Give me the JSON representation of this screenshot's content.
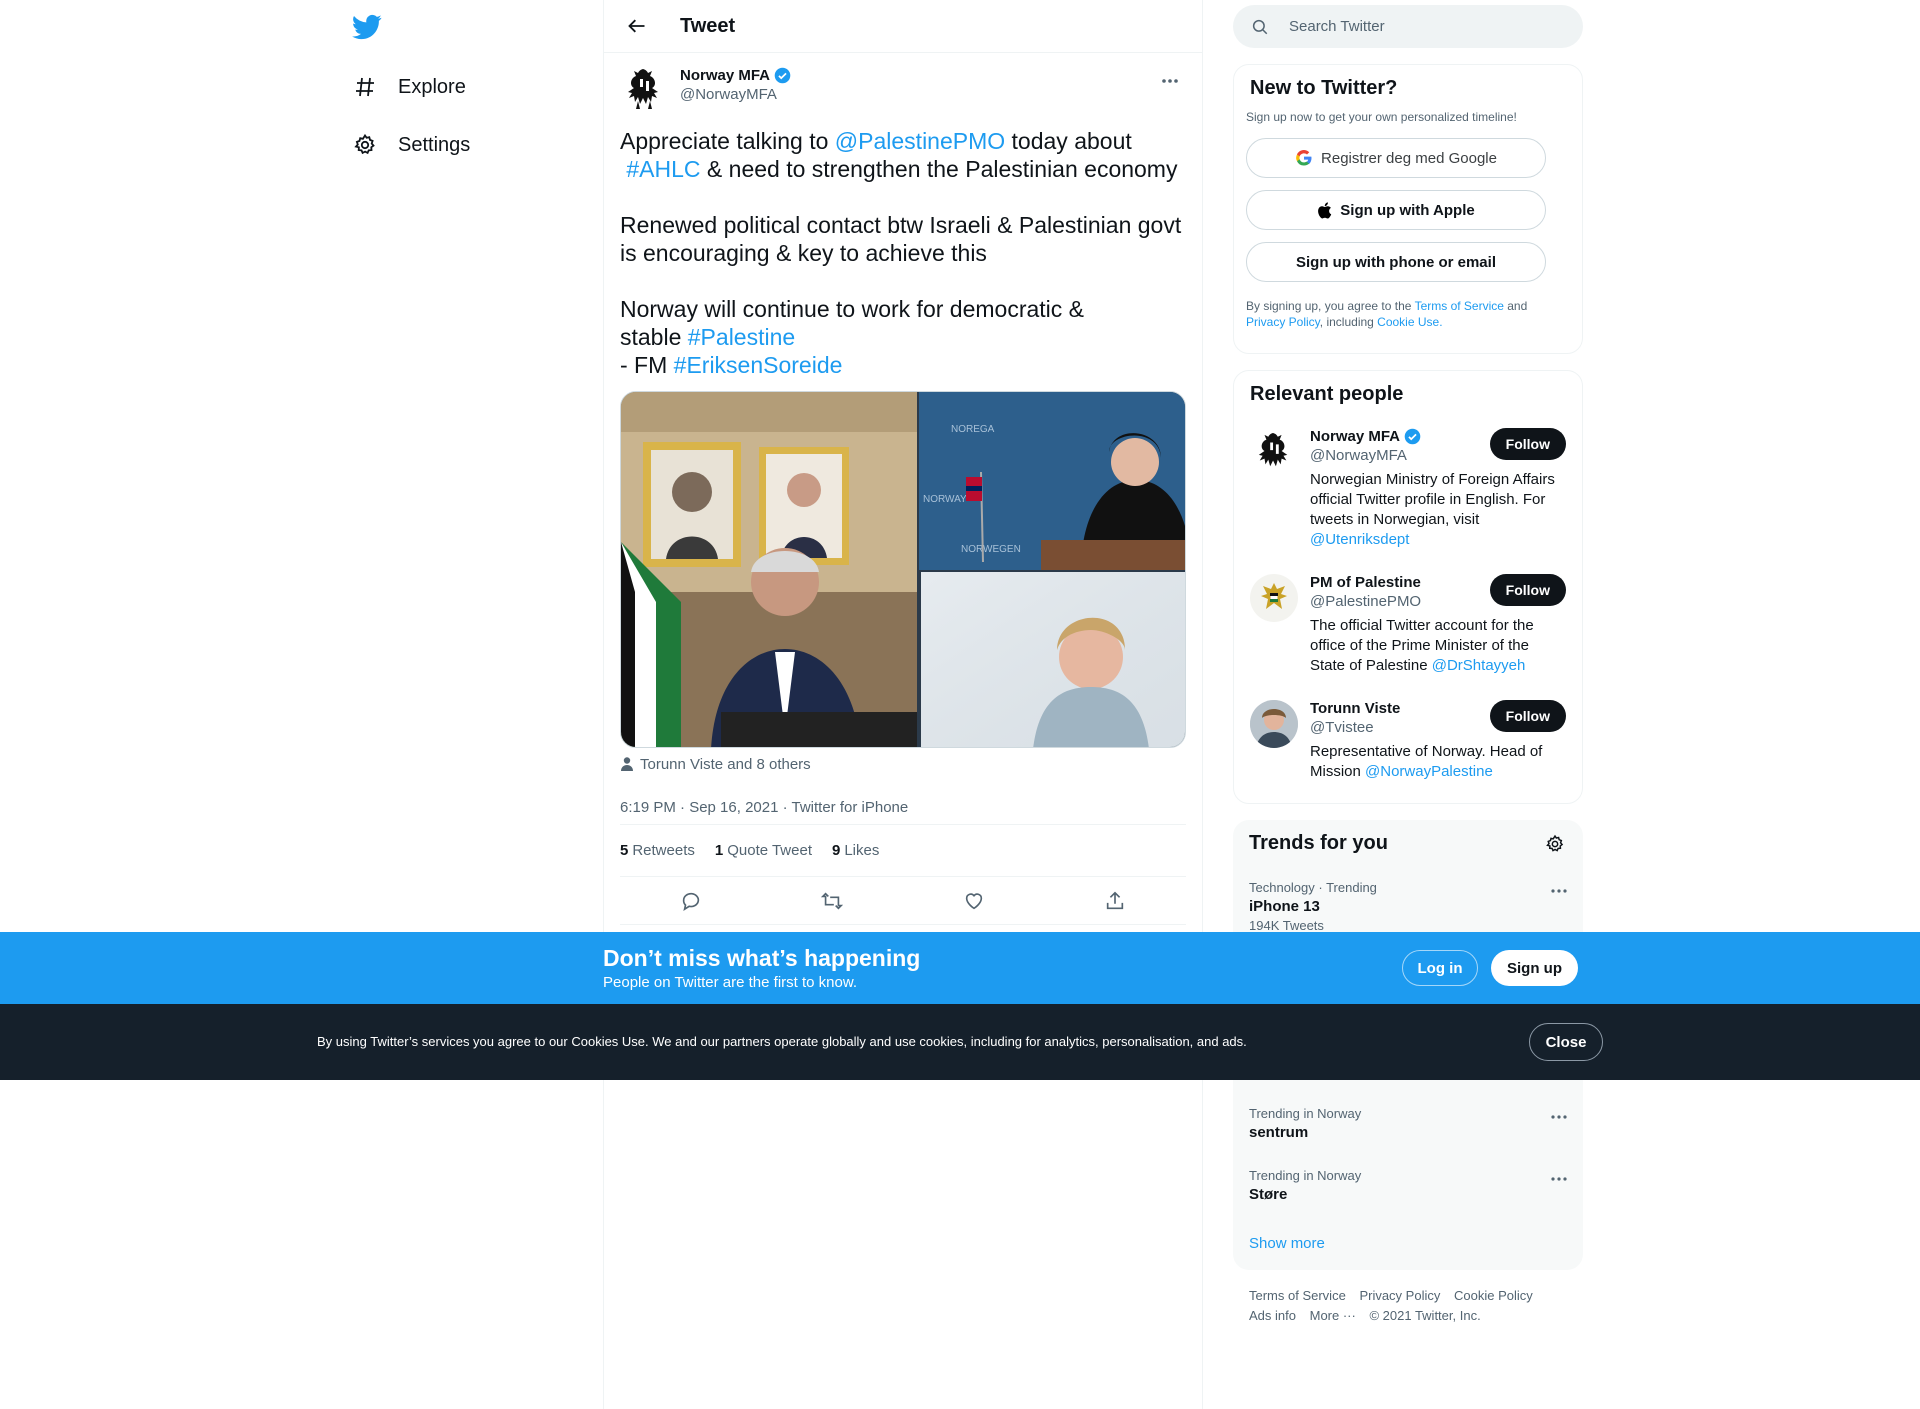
{
  "nav": {
    "logo": "twitter-bird-icon",
    "items": [
      {
        "label": "Explore",
        "icon": "hashtag-icon"
      },
      {
        "label": "Settings",
        "icon": "gear-icon"
      }
    ]
  },
  "main": {
    "title": "Tweet",
    "tweet": {
      "author_name": "Norway MFA",
      "author_handle": "@NorwayMFA",
      "text_parts": {
        "l1a": "Appreciate talking to ",
        "l1_mention": "@PalestinePMO",
        "l1b": " today about",
        "l2_hashtag": "#AHLC",
        "l2b": " & need to strengthen the Palestinian economy",
        "p2": "Renewed political contact btw Israeli & Palestinian govt is encouraging & key to achieve this",
        "p3a": "Norway will continue to work for democratic &",
        "p3b": "stable ",
        "p3_hashtag": "#Palestine",
        "p3c": "- FM ",
        "p3_hashtag2": "#EriksenSoreide"
      },
      "tagged": "Torunn Viste and 8 others",
      "meta": "6:19 PM · Sep 16, 2021 · Twitter for iPhone",
      "stats": {
        "retweets_count": "5",
        "retweets_label": "Retweets",
        "quotes_count": "1",
        "quotes_label": "Quote Tweet",
        "likes_count": "9",
        "likes_label": "Likes"
      },
      "media_labels": {
        "flag_caption": "NORWAY",
        "sign1": "NOREGA",
        "sign2": "NORWAY",
        "sign3": "NORWEGEN"
      }
    }
  },
  "right": {
    "search_placeholder": "Search Twitter",
    "signup": {
      "title": "New to Twitter?",
      "subtitle": "Sign up now to get your own personalized timeline!",
      "google": "Registrer deg med Google",
      "apple": "Sign up with Apple",
      "phone": "Sign up with phone or email",
      "legal_a": "By signing up, you agree to the ",
      "legal_tos": "Terms of Service",
      "legal_b": " and ",
      "legal_pp": "Privacy Policy",
      "legal_c": ", including ",
      "legal_cu": "Cookie Use",
      "legal_d": "."
    },
    "people": {
      "title": "Relevant people",
      "follow_label": "Follow",
      "list": [
        {
          "name": "Norway MFA",
          "handle": "@NorwayMFA",
          "bio": "Norwegian Ministry of Foreign Affairs official Twitter profile in English. For tweets in Norwegian, visit ",
          "bio_link": "@Utenriksdept"
        },
        {
          "name": "PM of Palestine",
          "handle": "@PalestinePMO",
          "bio": "The official Twitter account for the office of the Prime Minister of the State of Palestine ",
          "bio_link": "@DrShtayyeh"
        },
        {
          "name": "Torunn Viste",
          "handle": "@Tvistee",
          "bio": "Representative of Norway. Head of Mission ",
          "bio_link": "@NorwayPalestine"
        }
      ]
    },
    "trends": {
      "title": "Trends for you",
      "items": [
        {
          "context": "Technology · Trending",
          "name": "iPhone 13",
          "count": "194K Tweets"
        },
        {
          "context": "Trending in Norway",
          "name": "sentrum",
          "count": ""
        },
        {
          "context": "Trending in Norway",
          "name": "Støre",
          "count": ""
        }
      ],
      "show_more": "Show more"
    },
    "footer": {
      "links": [
        "Terms of Service",
        "Privacy Policy",
        "Cookie Policy",
        "Ads info",
        "More ···",
        "© 2021 Twitter, Inc."
      ]
    }
  },
  "banner": {
    "title": "Don’t miss what’s happening",
    "subtitle": "People on Twitter are the first to know.",
    "login": "Log in",
    "signup": "Sign up"
  },
  "cookie": {
    "text": "By using Twitter’s services you agree to our Cookies Use. We and our partners operate globally and use cookies, including for analytics, personalisation, and ads.",
    "close": "Close"
  },
  "colors": {
    "accent": "#1d9bf0",
    "text": "#0f1419",
    "muted": "#536471",
    "cookie_bg": "#15202b"
  }
}
